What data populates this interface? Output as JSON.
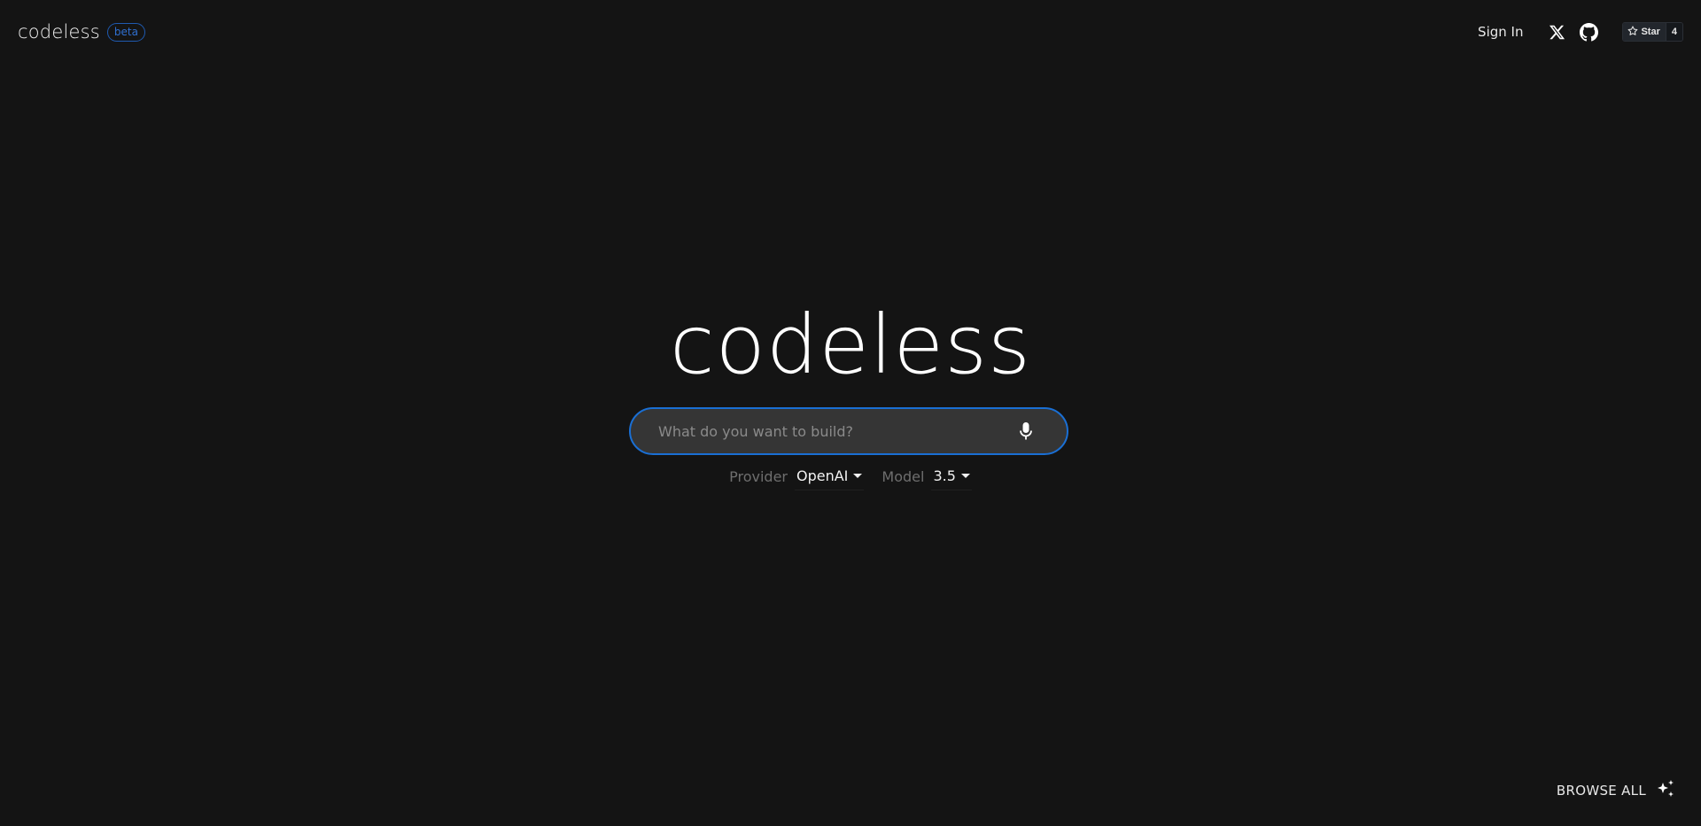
{
  "header": {
    "brand": "codeless",
    "badge": "beta",
    "sign_in": "Sign In",
    "x_icon": "x-twitter-icon",
    "github_icon": "github-icon",
    "github_star": {
      "label": "Star",
      "count": "4",
      "icon": "star-outline-icon"
    }
  },
  "hero": {
    "title": "codeless"
  },
  "search": {
    "placeholder": "What do you want to build?",
    "value": "",
    "mic_icon": "microphone-icon"
  },
  "options": {
    "provider_label": "Provider",
    "provider_value": "OpenAI",
    "model_label": "Model",
    "model_value": "3.5"
  },
  "footer": {
    "browse_all": "BROWSE ALL",
    "browse_icon": "sparkles-icon"
  },
  "colors": {
    "background": "#141414",
    "accent": "#1a6fd4",
    "input_bg": "#353535"
  }
}
